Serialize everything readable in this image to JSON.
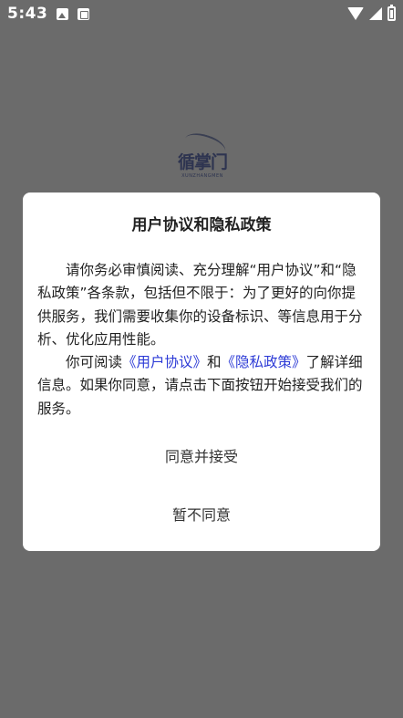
{
  "status_bar": {
    "time": "5:43",
    "icons": [
      "image-icon",
      "app-icon",
      "wifi-icon",
      "signal-icon",
      "battery-icon"
    ]
  },
  "background": {
    "overlay_color": "#6b6b6b",
    "logo_text": "循掌门",
    "logo_subtext": "XUNZHANGMEN"
  },
  "dialog": {
    "title": "用户协议和隐私政策",
    "paragraph1": "请你务必审慎阅读、充分理解“用户协议”和“隐私政策”各条款，包括但不限于：为了更好的向你提供服务，我们需要收集你的设备标识、等信息用于分析、优化应用性能。",
    "paragraph2_prefix": "你可阅读",
    "user_agreement_link": "《用户协议》",
    "paragraph2_and": "和",
    "privacy_policy_link": "《隐私政策》",
    "paragraph2_suffix": "了解详细信息。如果你同意，请点击下面按钮开始接受我们的服务。",
    "agree_button": "同意并接受",
    "disagree_button": "暂不同意",
    "link_color": "#2d3bd6"
  }
}
